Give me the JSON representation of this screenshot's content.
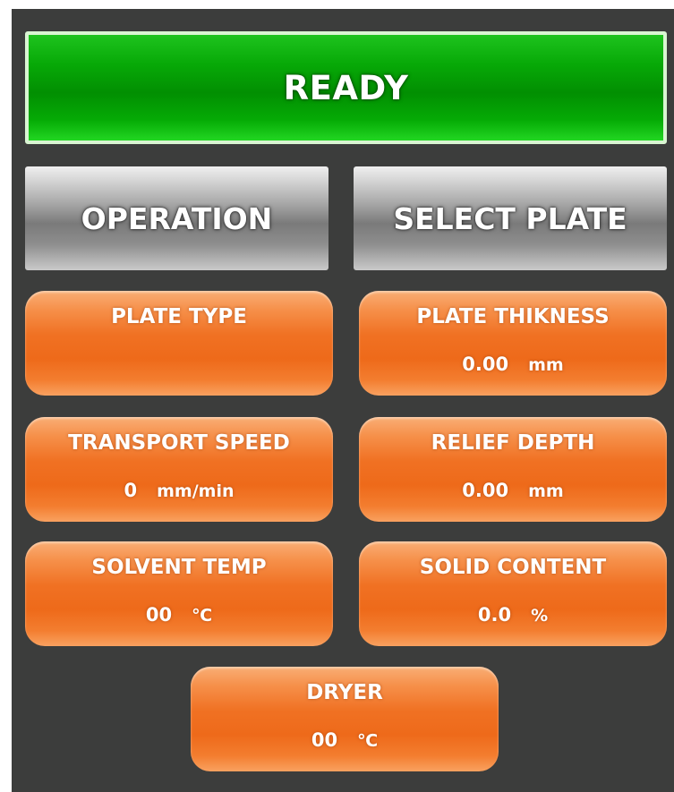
{
  "status": {
    "label": "READY",
    "color": "#07a907"
  },
  "buttons": {
    "operation": "OPERATION",
    "select_plate": "SELECT PLATE"
  },
  "tiles": {
    "plate_type": {
      "label": "PLATE TYPE"
    },
    "plate_thickness": {
      "label": "PLATE THIKNESS",
      "value": "0.00",
      "unit": "mm"
    },
    "transport_speed": {
      "label": "TRANSPORT SPEED",
      "value": "0",
      "unit": "mm/min"
    },
    "relief_depth": {
      "label": "RELIEF DEPTH",
      "value": "0.00",
      "unit": "mm"
    },
    "solvent_temp": {
      "label": "SOLVENT TEMP",
      "value": "00",
      "unit": "℃"
    },
    "solid_content": {
      "label": "SOLID CONTENT",
      "value": "0.0",
      "unit": "%"
    },
    "dryer": {
      "label": "DRYER",
      "value": "00",
      "unit": "℃"
    }
  },
  "colors": {
    "background": "#3c3d3c",
    "tile_accent": "#f07123",
    "button_gray": "#a9a9a9"
  }
}
